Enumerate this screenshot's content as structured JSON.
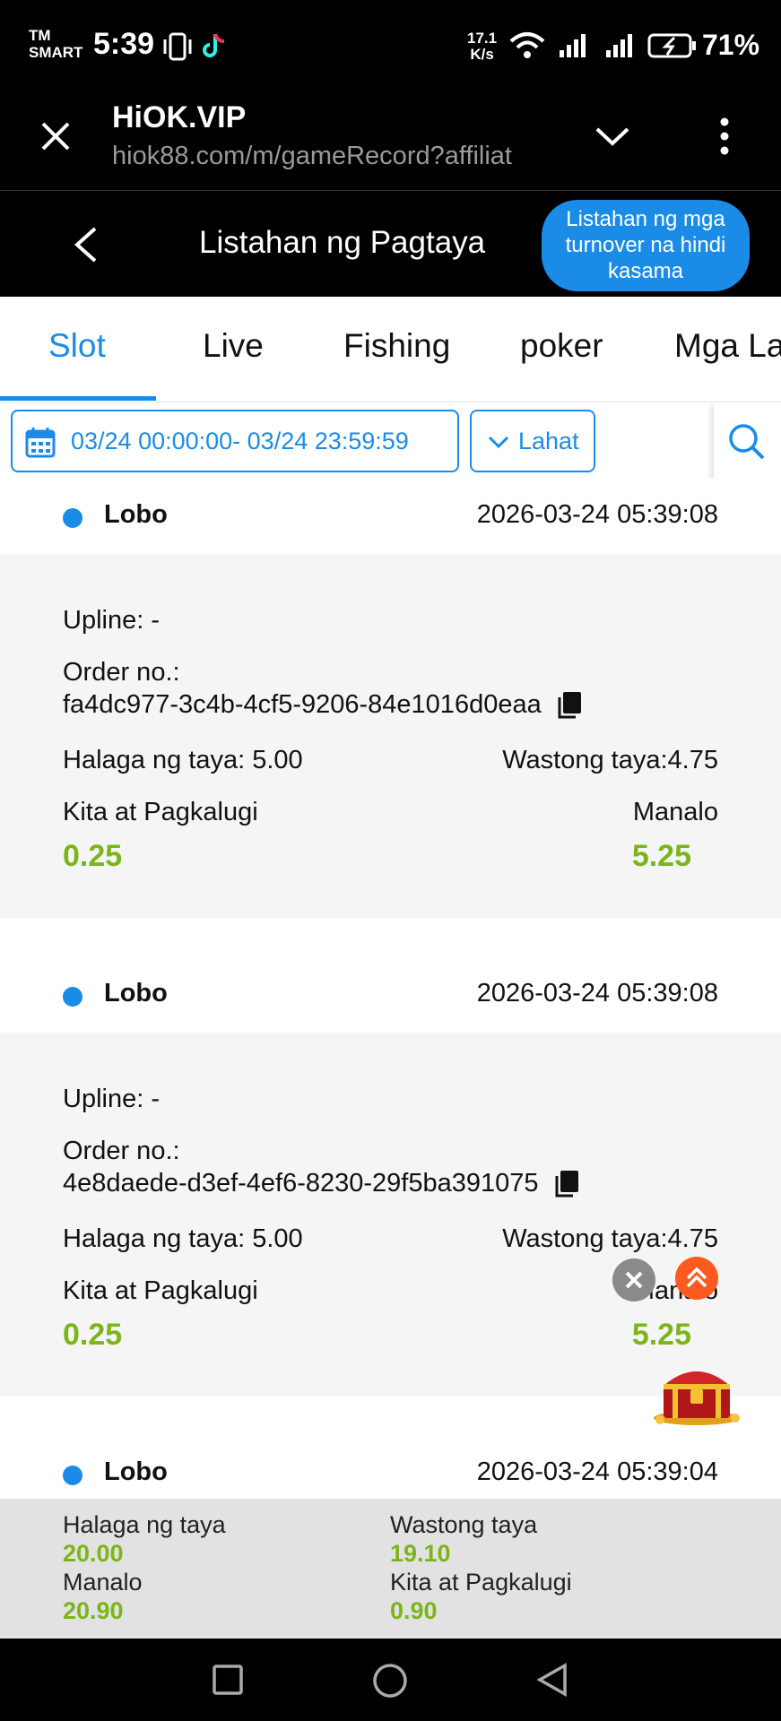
{
  "status_bar": {
    "carrier_line1": "TM",
    "carrier_line2": "SMART",
    "time": "5:39",
    "net_speed_top": "17.1",
    "net_speed_bottom": "K/s",
    "battery": "71%"
  },
  "browser": {
    "title": "HiOK.VIP",
    "url": "hiok88.com/m/gameRecord?affiliat"
  },
  "header": {
    "title": "Listahan ng Pagtaya",
    "turnover_button": "Listahan ng mga turnover na hindi kasama"
  },
  "tabs": [
    {
      "label": "Slot",
      "active": true
    },
    {
      "label": "Live",
      "active": false
    },
    {
      "label": "Fishing",
      "active": false
    },
    {
      "label": "poker",
      "active": false
    },
    {
      "label": "Mga La",
      "active": false
    }
  ],
  "filter": {
    "date_range": "03/24 00:00:00- 03/24 23:59:59",
    "category": "Lahat"
  },
  "records": [
    {
      "name": "Lobo",
      "time": "2026-03-24 05:39:08",
      "upline": "Upline: -",
      "order_label": "Order no.:",
      "order_no": "fa4dc977-3c4b-4cf5-9206-84e1016d0eaa",
      "bet_amount": "Halaga ng taya: 5.00",
      "valid_bet": "Wastong taya:4.75",
      "profit_label": "Kita at Pagkalugi",
      "win_label": "Manalo",
      "profit_value": "0.25",
      "win_value": "5.25"
    },
    {
      "name": "Lobo",
      "time": "2026-03-24 05:39:08",
      "upline": "Upline: -",
      "order_label": "Order no.:",
      "order_no": "4e8daede-d3ef-4ef6-8230-29f5ba391075",
      "bet_amount": "Halaga ng taya: 5.00",
      "valid_bet": "Wastong taya:4.75",
      "profit_label": "Kita at Pagkalugi",
      "win_label": "Manalo",
      "profit_value": "0.25",
      "win_value": "5.25"
    },
    {
      "name": "Lobo",
      "time": "2026-03-24 05:39:04"
    }
  ],
  "summary": {
    "bet_label": "Halaga ng taya",
    "bet_value": "20.00",
    "valid_label": "Wastong taya",
    "valid_value": "19.10",
    "win_label": "Manalo",
    "win_value": "20.90",
    "profit_label": "Kita at Pagkalugi",
    "profit_value": "0.90"
  },
  "colors": {
    "accent": "#1a8ce8",
    "money_green": "#7cb51a",
    "float_up": "#ff5a1f"
  }
}
